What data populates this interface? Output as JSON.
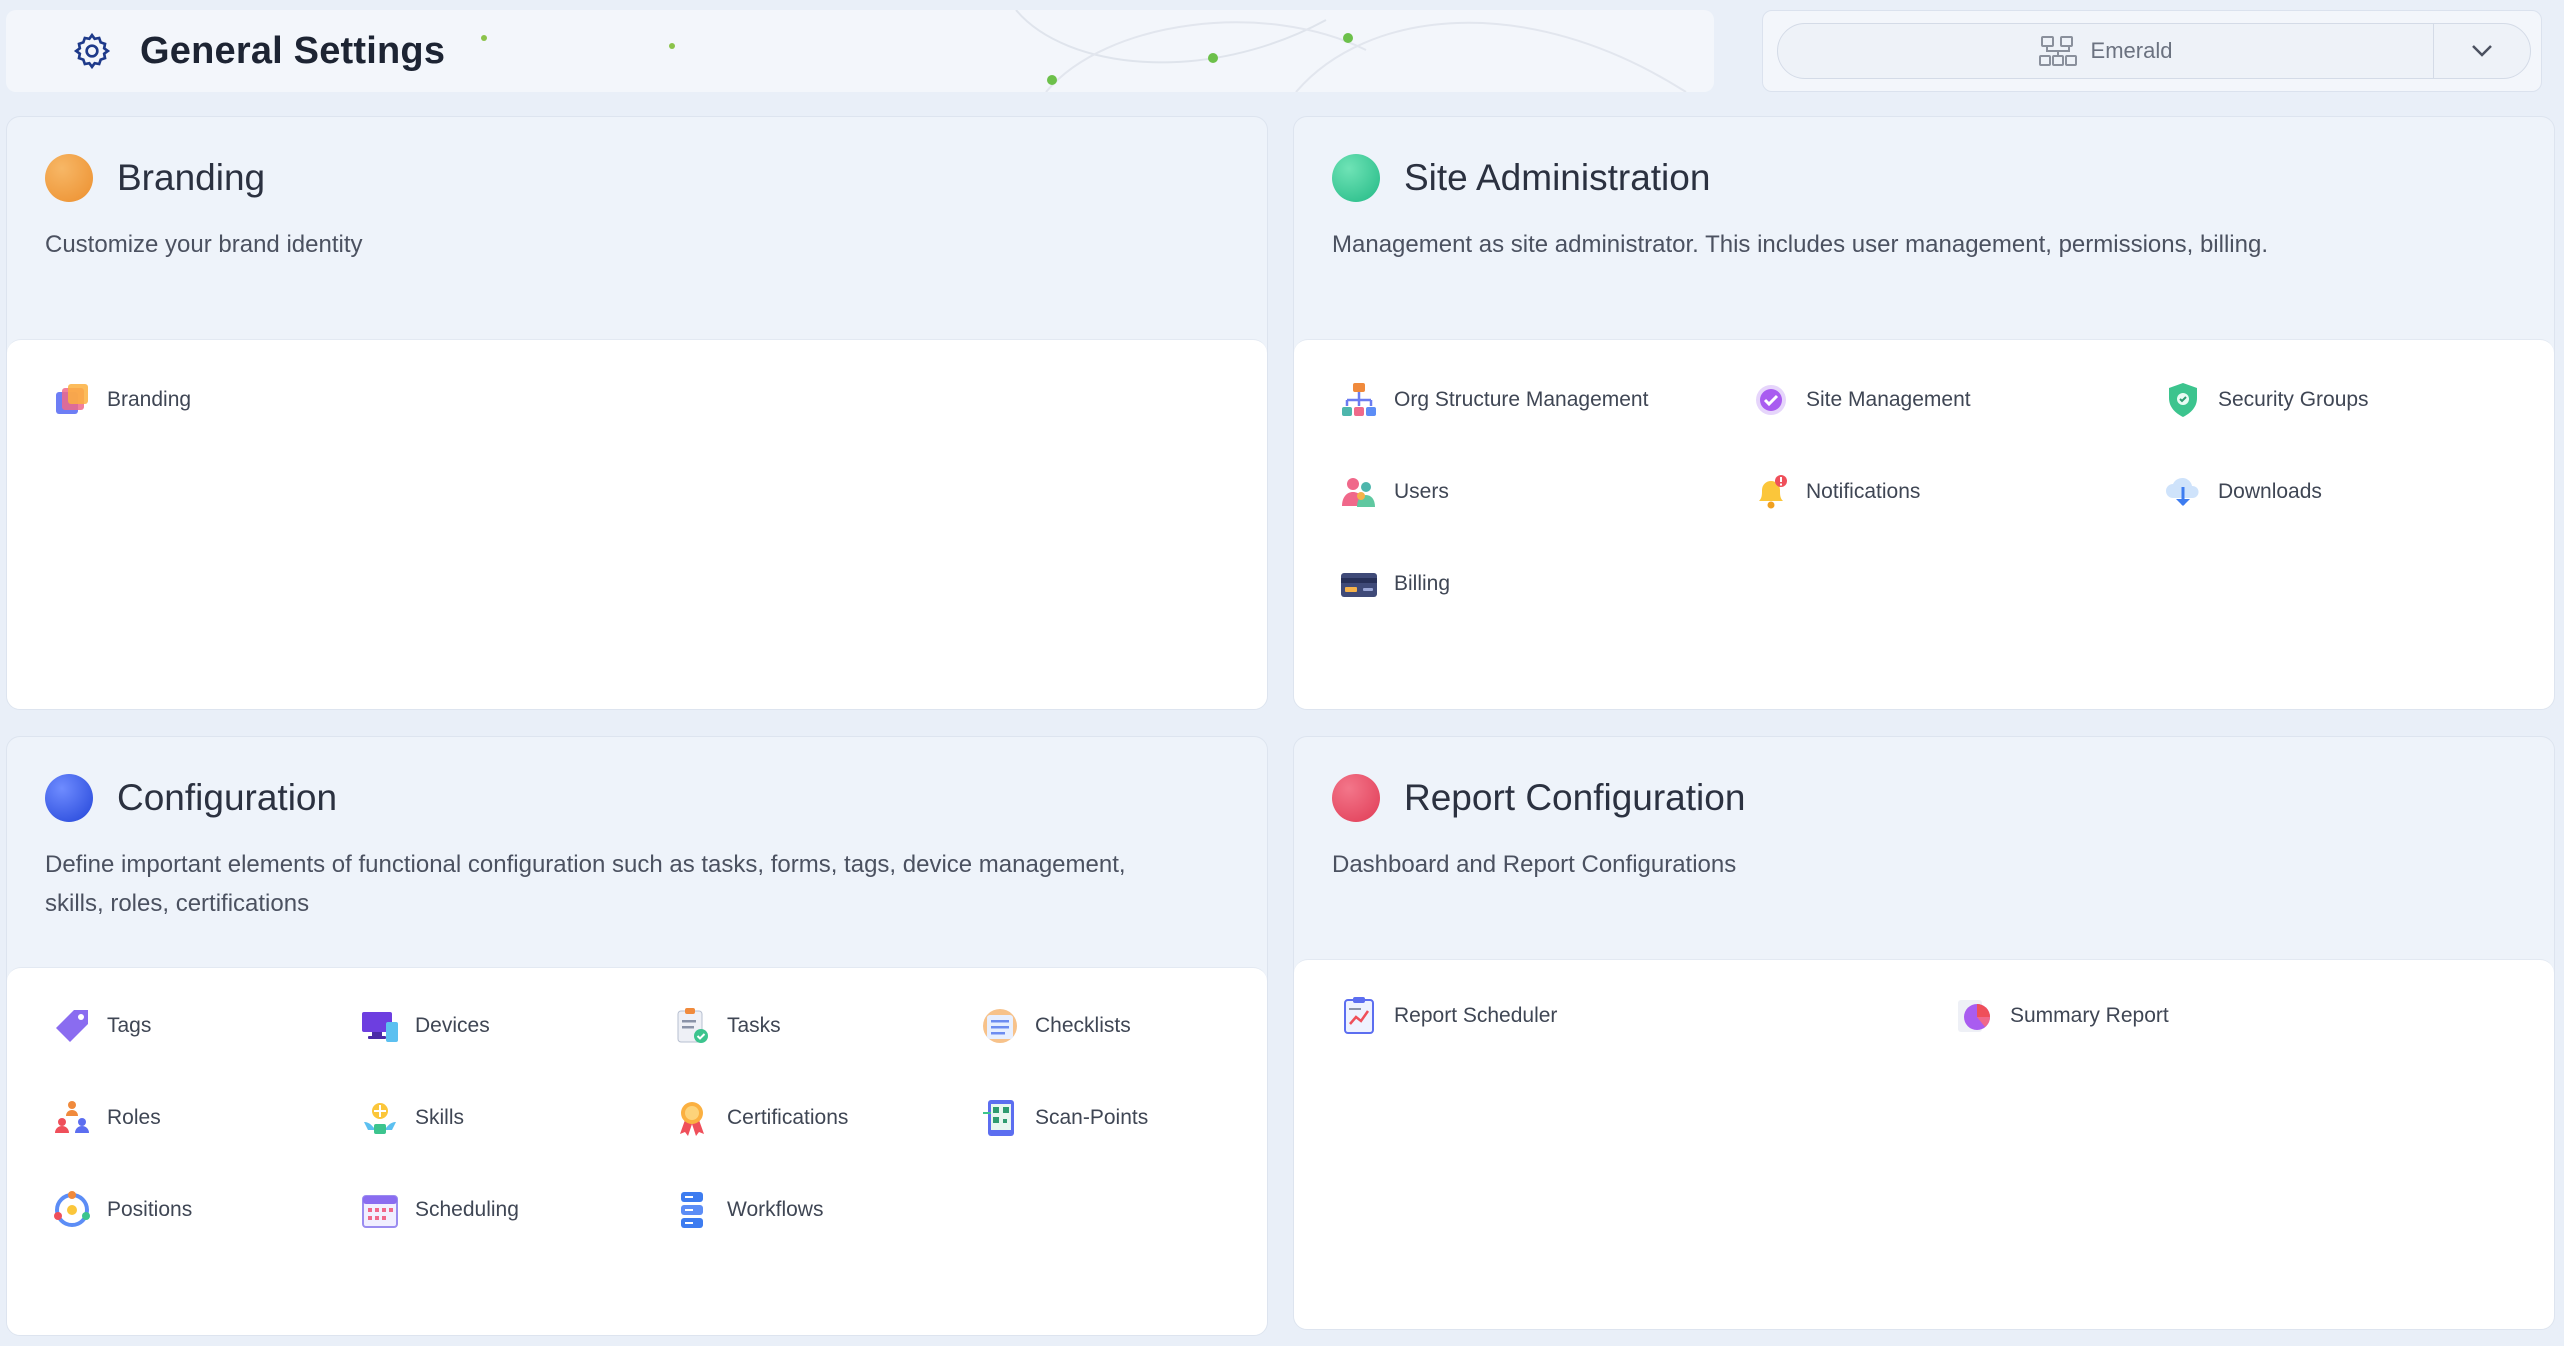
{
  "header": {
    "title": "General Settings",
    "gear_icon": "gear-icon"
  },
  "site_selector": {
    "value": "Emerald",
    "icon": "org-chart-icon",
    "chevron": "chevron-down-icon"
  },
  "cards": {
    "branding": {
      "title": "Branding",
      "dot_color": "#f0a04b",
      "description": "Customize your brand identity",
      "items": [
        {
          "label": "Branding",
          "icon": "layers-icon"
        }
      ]
    },
    "site_admin": {
      "title": "Site Administration",
      "dot_color": "#3ccf9a",
      "description": "Management as site administrator. This includes user management, permissions, billing.",
      "items": [
        {
          "label": "Org Structure Management",
          "icon": "org-structure-icon"
        },
        {
          "label": "Site Management",
          "icon": "verified-badge-icon"
        },
        {
          "label": "Security Groups",
          "icon": "shield-icon"
        },
        {
          "label": "Users",
          "icon": "users-icon"
        },
        {
          "label": "Notifications",
          "icon": "bell-icon"
        },
        {
          "label": "Downloads",
          "icon": "cloud-download-icon"
        },
        {
          "label": "Billing",
          "icon": "credit-card-icon"
        }
      ]
    },
    "configuration": {
      "title": "Configuration",
      "dot_color": "#3d5ff0",
      "description": "Define important elements of functional configuration such as tasks, forms, tags, device management, skills, roles, certifications",
      "items": [
        {
          "label": "Tags",
          "icon": "tag-icon"
        },
        {
          "label": "Devices",
          "icon": "devices-icon"
        },
        {
          "label": "Tasks",
          "icon": "clipboard-check-icon"
        },
        {
          "label": "Checklists",
          "icon": "checklist-icon"
        },
        {
          "label": "Roles",
          "icon": "roles-icon"
        },
        {
          "label": "Skills",
          "icon": "skills-icon"
        },
        {
          "label": "Certifications",
          "icon": "award-icon"
        },
        {
          "label": "Scan-Points",
          "icon": "qr-scan-icon"
        },
        {
          "label": "Positions",
          "icon": "positions-icon"
        },
        {
          "label": "Scheduling",
          "icon": "calendar-icon"
        },
        {
          "label": "Workflows",
          "icon": "workflow-icon"
        }
      ]
    },
    "report_config": {
      "title": "Report Configuration",
      "dot_color": "#ea4f68",
      "description": "Dashboard and Report Configurations",
      "items": [
        {
          "label": "Report Scheduler",
          "icon": "report-scheduler-icon"
        },
        {
          "label": "Summary Report",
          "icon": "pie-chart-icon"
        }
      ]
    }
  }
}
